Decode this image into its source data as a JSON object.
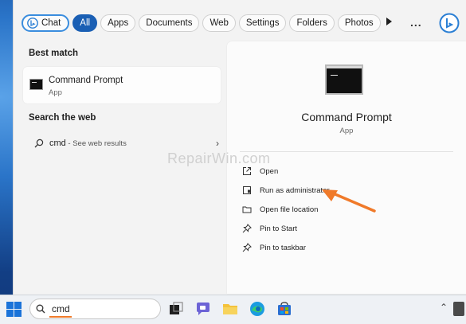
{
  "filters": {
    "chat_label": "Chat",
    "all_label": "All",
    "apps_label": "Apps",
    "documents_label": "Documents",
    "web_label": "Web",
    "settings_label": "Settings",
    "folders_label": "Folders",
    "photos_label": "Photos",
    "more_label": "..."
  },
  "best_match": {
    "heading": "Best match",
    "name": "Command Prompt",
    "type": "App"
  },
  "web": {
    "heading": "Search the web",
    "query": "cmd",
    "suffix": " - See web results"
  },
  "preview": {
    "title": "Command Prompt",
    "type": "App",
    "actions": [
      {
        "label": "Open",
        "icon": "open-icon"
      },
      {
        "label": "Run as administrator",
        "icon": "shield-icon"
      },
      {
        "label": "Open file location",
        "icon": "folder-icon"
      },
      {
        "label": "Pin to Start",
        "icon": "pin-icon"
      },
      {
        "label": "Pin to taskbar",
        "icon": "pin-icon"
      }
    ]
  },
  "watermark": "RepairWin.com",
  "taskbar": {
    "search_value": "cmd"
  },
  "colors": {
    "accent": "#1a5fb4",
    "annotation_arrow": "#f07a2a"
  }
}
